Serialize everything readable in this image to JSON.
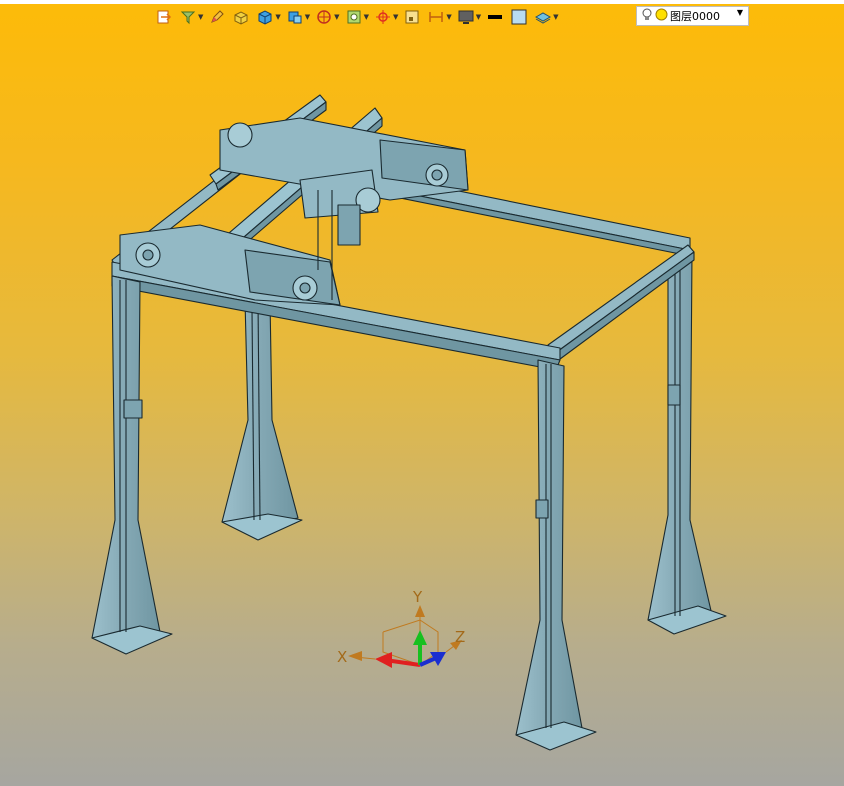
{
  "toolbar": {
    "tools": [
      {
        "name": "export-icon",
        "dropdown": false
      },
      {
        "name": "layer-filter-icon",
        "dropdown": true
      },
      {
        "name": "pencil-icon",
        "dropdown": false
      },
      {
        "name": "box-yellow-icon",
        "dropdown": false
      },
      {
        "name": "solid-cube-icon",
        "dropdown": true
      },
      {
        "name": "view-cube-icon",
        "dropdown": true
      },
      {
        "name": "target-icon",
        "dropdown": true
      },
      {
        "name": "snap-icon",
        "dropdown": true
      },
      {
        "name": "crosshair-icon",
        "dropdown": true
      },
      {
        "name": "frame-icon",
        "dropdown": false
      },
      {
        "name": "dimension-icon",
        "dropdown": true
      },
      {
        "name": "monitor-icon",
        "dropdown": true
      },
      {
        "name": "line-weight-icon",
        "dropdown": false
      },
      {
        "name": "color-swatch-icon",
        "dropdown": false
      },
      {
        "name": "layers-icon",
        "dropdown": true
      }
    ],
    "layer": {
      "label": "图层0000",
      "bulb_icon": "lightbulb-icon",
      "state_icon": "yellow-circle-icon"
    }
  },
  "viewport": {
    "axis_triad": {
      "x": "X",
      "y": "Y",
      "z": "Z"
    },
    "colors": {
      "x_axis": "#e02020",
      "y_axis": "#18c020",
      "z_axis": "#1a2ed0",
      "model": "#8ab0bc",
      "model_edge": "#1a2a30"
    }
  }
}
